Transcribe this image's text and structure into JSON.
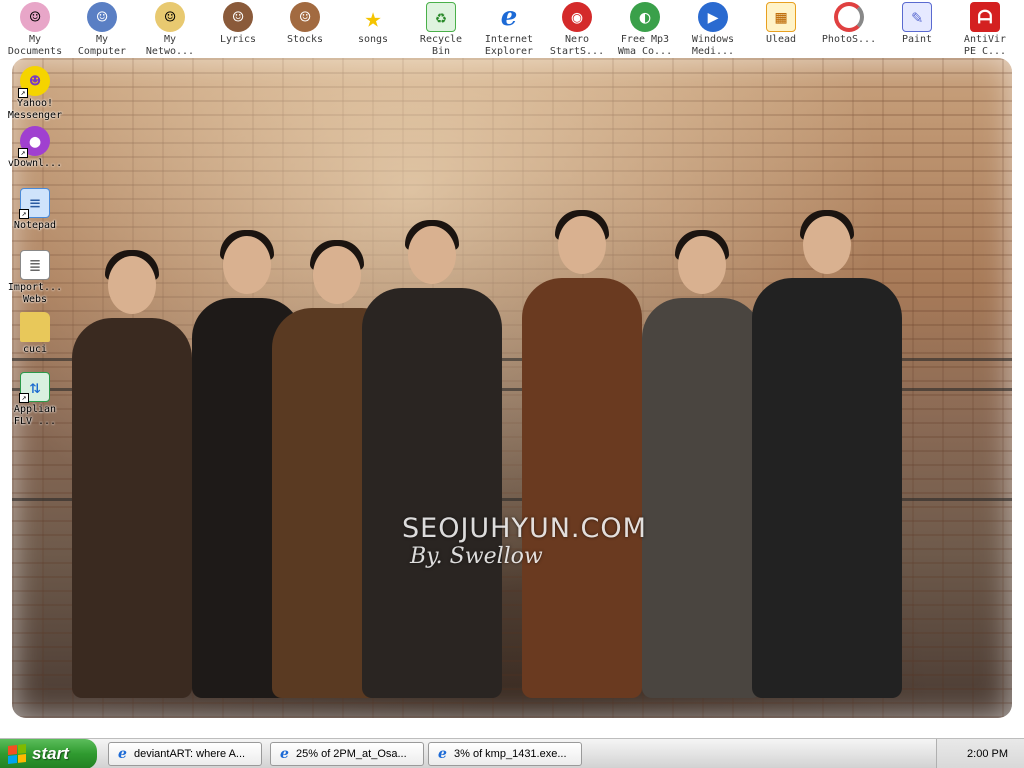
{
  "desktop": {
    "watermark": {
      "line1": "SEOJUHYUN.COM",
      "line2": "By. Swellow"
    },
    "top_icons": [
      {
        "label": "My\nDocuments",
        "icon": "avatar-girl-icon",
        "color": "#e8a6c8"
      },
      {
        "label": "My\nComputer",
        "icon": "avatar-boy-icon",
        "color": "#5a7fc4"
      },
      {
        "label": "My\nNetwo...",
        "icon": "avatar-blonde-icon",
        "color": "#e8c970"
      },
      {
        "label": "Lyrics",
        "icon": "avatar-cap-icon",
        "color": "#8a5a3a"
      },
      {
        "label": "Stocks",
        "icon": "avatar-brown-hair-icon",
        "color": "#a26a40"
      },
      {
        "label": "songs",
        "icon": "star-icon",
        "color": "#f5c400"
      },
      {
        "label": "Recycle\nBin",
        "icon": "recycle-bin-icon",
        "color": "#4ab04a"
      },
      {
        "label": "Internet\nExplorer",
        "icon": "internet-explorer-icon",
        "color": "#1c6ad6"
      },
      {
        "label": "Nero\nStartS...",
        "icon": "nero-icon",
        "color": "#d42a2a"
      },
      {
        "label": "Free Mp3\nWma Co...",
        "icon": "mp3-converter-icon",
        "color": "#3aa04a"
      },
      {
        "label": "Windows\nMedi...",
        "icon": "windows-media-player-icon",
        "color": "#2a6ad0"
      },
      {
        "label": "Ulead",
        "icon": "ulead-icon",
        "color": "#e8a020"
      },
      {
        "label": "PhotoS...",
        "icon": "photoscape-icon",
        "color": "#e04040"
      },
      {
        "label": "Paint",
        "icon": "paint-icon",
        "color": "#5a6ad0"
      },
      {
        "label": "AntiVir\nPE C...",
        "icon": "antivir-icon",
        "color": "#d42020"
      }
    ],
    "side_icons": [
      {
        "label": "Yahoo!\nMessenger",
        "icon": "yahoo-messenger-icon",
        "color": "#7a3ac0"
      },
      {
        "label": "vDownl...",
        "icon": "vdownloader-icon",
        "color": "#a040d0"
      },
      {
        "label": "Notepad",
        "icon": "notepad-icon",
        "color": "#4a8ad8"
      },
      {
        "label": "Import...\nWebs",
        "icon": "document-icon",
        "color": "#d0d0d0"
      },
      {
        "label": "cuci",
        "icon": "folder-icon",
        "color": "#e8c85a"
      },
      {
        "label": "Applian\nFLV ...",
        "icon": "applian-flv-icon",
        "color": "#2a9a4a"
      }
    ]
  },
  "taskbar": {
    "start_label": "start",
    "tasks": [
      {
        "label": "deviantART: where A..."
      },
      {
        "label": "25% of 2PM_at_Osa..."
      },
      {
        "label": "3% of kmp_1431.exe..."
      }
    ],
    "clock": "2:00 PM",
    "tray_arrow": "‹"
  }
}
